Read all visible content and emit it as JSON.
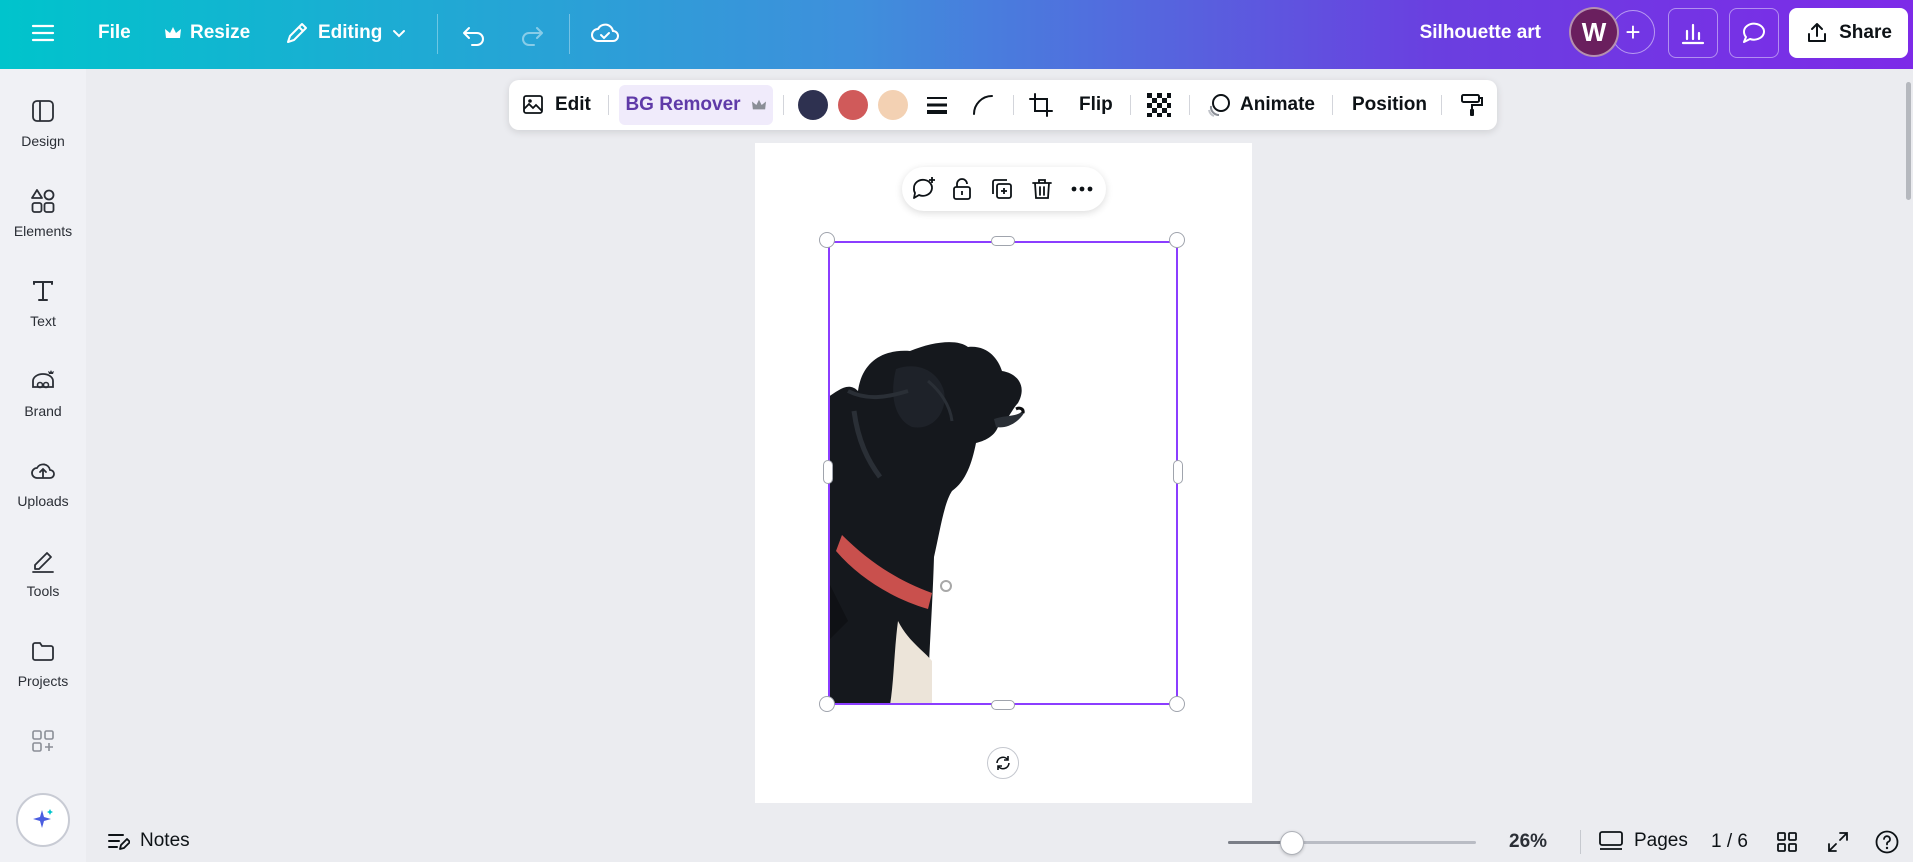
{
  "topbar": {
    "file_label": "File",
    "resize_label": "Resize",
    "editing_label": "Editing",
    "design_title": "Silhouette art",
    "avatar_initial": "W",
    "share_label": "Share",
    "gradient_start": "#00c4cc",
    "gradient_end": "#7d2ae8"
  },
  "sidebar": {
    "items": [
      {
        "label": "Design",
        "icon": "layout-icon"
      },
      {
        "label": "Elements",
        "icon": "shapes-icon"
      },
      {
        "label": "Text",
        "icon": "text-t-icon"
      },
      {
        "label": "Brand",
        "icon": "brand-icon"
      },
      {
        "label": "Uploads",
        "icon": "cloud-upload-icon"
      },
      {
        "label": "Tools",
        "icon": "pen-tools-icon"
      },
      {
        "label": "Projects",
        "icon": "folder-icon"
      },
      {
        "label": "",
        "icon": "apps-icon"
      }
    ]
  },
  "context_toolbar": {
    "edit_label": "Edit",
    "bg_remover_label": "BG Remover",
    "flip_label": "Flip",
    "animate_label": "Animate",
    "position_label": "Position",
    "swatches": [
      "#2e3150",
      "#d05a5a",
      "#f3d1b3"
    ]
  },
  "selection": {
    "accent_color": "#8b3dff"
  },
  "bottombar": {
    "notes_label": "Notes",
    "zoom_value": "26%",
    "zoom_fraction": 0.26,
    "pages_label": "Pages",
    "page_counter": "1 / 6"
  }
}
